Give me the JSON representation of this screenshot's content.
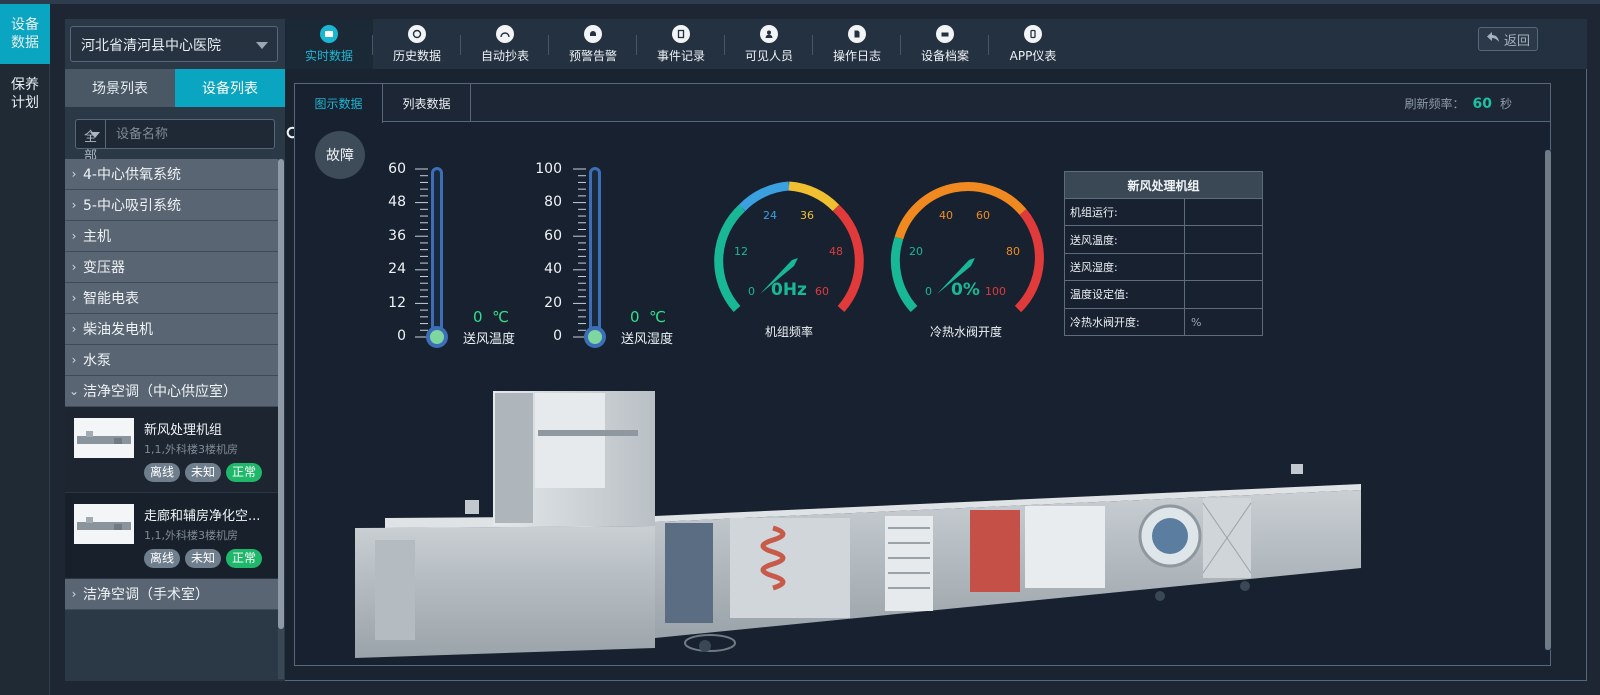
{
  "leftnav": [
    {
      "label": "设备数据"
    },
    {
      "label": "保养计划"
    }
  ],
  "sidebar": {
    "hospital": "河北省清河县中心医院",
    "tabs": [
      {
        "label": "场景列表"
      },
      {
        "label": "设备列表"
      }
    ],
    "search": {
      "scope": "全部",
      "placeholder": "设备名称"
    },
    "groups_top": [
      "4-中心供氧系统",
      "5-中心吸引系统",
      "主机",
      "变压器",
      "智能电表",
      "柴油发电机",
      "水泵",
      "洁净空调（中心供应室）"
    ],
    "devices": [
      {
        "name": "新风处理机组",
        "loc": "1,1,外科楼3楼机房",
        "badges": [
          "离线",
          "未知",
          "正常"
        ]
      },
      {
        "name": "走廊和辅房净化空...",
        "loc": "1,1,外科楼3楼机房",
        "badges": [
          "离线",
          "未知",
          "正常"
        ]
      }
    ],
    "group_bottom": "洁净空调（手术室）"
  },
  "toptabs": [
    {
      "label": "实时数据"
    },
    {
      "label": "历史数据"
    },
    {
      "label": "自动抄表"
    },
    {
      "label": "预警告警"
    },
    {
      "label": "事件记录"
    },
    {
      "label": "可见人员"
    },
    {
      "label": "操作日志"
    },
    {
      "label": "设备档案"
    },
    {
      "label": "APP仪表"
    }
  ],
  "back_label": "返回",
  "panel": {
    "tabs": [
      {
        "label": "图示数据"
      },
      {
        "label": "列表数据"
      }
    ],
    "refresh_label": "刷新频率：",
    "refresh_value": "60",
    "refresh_unit": "秒",
    "fault_label": "故障"
  },
  "thermometers": [
    {
      "ticks": [
        "60",
        "48",
        "36",
        "24",
        "12",
        "0"
      ],
      "value": "0",
      "unit": "℃",
      "label": "送风温度",
      "fill": 0
    },
    {
      "ticks": [
        "100",
        "80",
        "60",
        "40",
        "20",
        "0"
      ],
      "value": "0",
      "unit": "℃",
      "label": "送风湿度",
      "fill": 0
    }
  ],
  "gauges": [
    {
      "ticks": [
        "0",
        "12",
        "24",
        "36",
        "48",
        "60"
      ],
      "value_text": "0Hz",
      "label": "机组频率",
      "value": 0,
      "max": 60
    },
    {
      "ticks": [
        "0",
        "20",
        "40",
        "60",
        "80",
        "100"
      ],
      "value_text": "0%",
      "label": "冷热水阀开度",
      "value": 0,
      "max": 100
    }
  ],
  "info_table": {
    "title": "新风处理机组",
    "rows": [
      {
        "key": "机组运行:",
        "value": ""
      },
      {
        "key": "送风温度:",
        "value": ""
      },
      {
        "key": "送风湿度:",
        "value": ""
      },
      {
        "key": "温度设定值:",
        "value": ""
      },
      {
        "key": "冷热水阀开度:",
        "value": "%"
      }
    ]
  },
  "colors": {
    "accent": "#0aa5c1",
    "value_green": "#2ee08a",
    "teal": "#1ec0a4",
    "gauge_teal": "#18b896",
    "gauge_blue": "#3aa0e0",
    "gauge_yellow": "#f0c030",
    "gauge_orange": "#f08a20",
    "gauge_red": "#e03a3a"
  }
}
